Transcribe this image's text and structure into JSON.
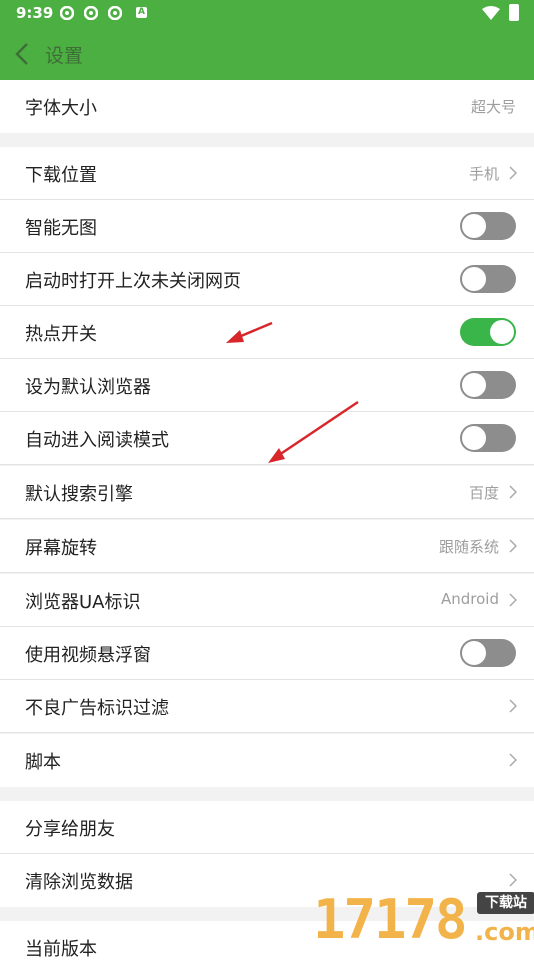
{
  "status_bar": {
    "time": "9:39",
    "notification_badge": "A"
  },
  "toolbar": {
    "title": "设置"
  },
  "rows": [
    {
      "label": "字体大小",
      "value": "超大号"
    },
    {
      "label": "下载位置",
      "value": "手机"
    },
    {
      "label": "智能无图",
      "toggle": false
    },
    {
      "label": "启动时打开上次未关闭网页",
      "toggle": false
    },
    {
      "label": "热点开关",
      "toggle": true
    },
    {
      "label": "设为默认浏览器",
      "toggle": false
    },
    {
      "label": "自动进入阅读模式",
      "toggle": false
    },
    {
      "label": "默认搜索引擎",
      "value": "百度"
    },
    {
      "label": "屏幕旋转",
      "value": "跟随系统"
    },
    {
      "label": "浏览器UA标识",
      "value": "Android"
    },
    {
      "label": "使用视频悬浮窗",
      "toggle": false
    },
    {
      "label": "不良广告标识过滤"
    },
    {
      "label": "脚本"
    },
    {
      "label": "分享给朋友"
    },
    {
      "label": "清除浏览数据"
    },
    {
      "label": "当前版本"
    }
  ],
  "watermark": {
    "digits": "17178",
    "badge": "下载站",
    "domain": ".com"
  },
  "colors": {
    "header": "#4caf42",
    "toggle_on": "#3ab54a",
    "toggle_off": "#8d8d8d",
    "annotation_arrow": "#d9262b"
  }
}
